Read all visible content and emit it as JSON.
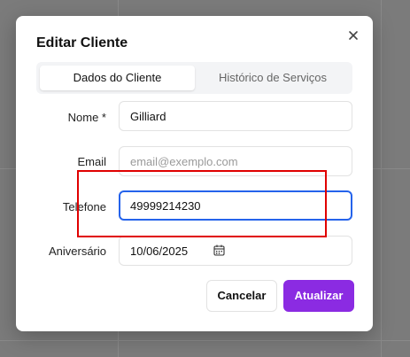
{
  "dialog": {
    "title": "Editar Cliente",
    "close_icon": "close-icon"
  },
  "tabs": [
    {
      "label": "Dados do Cliente",
      "active": true
    },
    {
      "label": "Histórico de Serviços",
      "active": false
    }
  ],
  "form": {
    "nome": {
      "label": "Nome *",
      "value": "Gilliard"
    },
    "email": {
      "label": "Email",
      "value": "",
      "placeholder": "email@exemplo.com"
    },
    "telefone": {
      "label": "Telefone",
      "value": "49999214230",
      "focused": true
    },
    "aniversario": {
      "label": "Aniversário",
      "value": "10/06/2025",
      "icon": "calendar-icon"
    }
  },
  "actions": {
    "cancel_label": "Cancelar",
    "update_label": "Atualizar"
  },
  "colors": {
    "accent": "#8b2be2",
    "focus_ring": "#2563eb",
    "annotation": "#e00000",
    "overlay": "#7b7b7b"
  }
}
